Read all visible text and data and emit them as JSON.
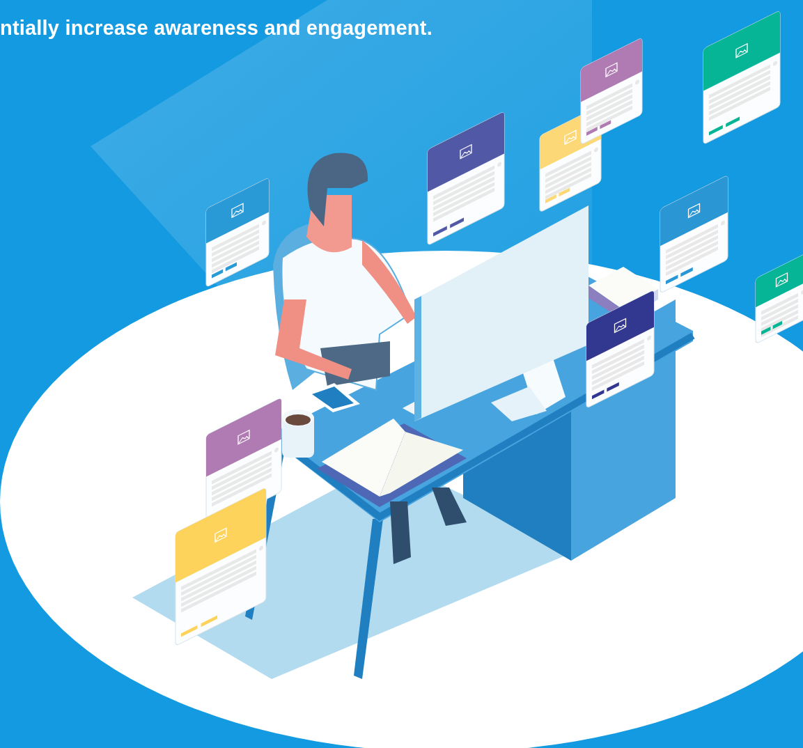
{
  "headline": {
    "text": "ntially increase awareness and engagement."
  },
  "cards": [
    {
      "color": "#2a9ad6"
    },
    {
      "color": "#5158a6"
    },
    {
      "color": "#fdd876"
    },
    {
      "color": "#b07ab3"
    },
    {
      "color": "#06b596"
    },
    {
      "color": "#2a96d4"
    },
    {
      "color": "#06b596"
    },
    {
      "color": "#32378f"
    },
    {
      "color": "#b07ab3"
    },
    {
      "color": "#fdd35c"
    }
  ]
}
